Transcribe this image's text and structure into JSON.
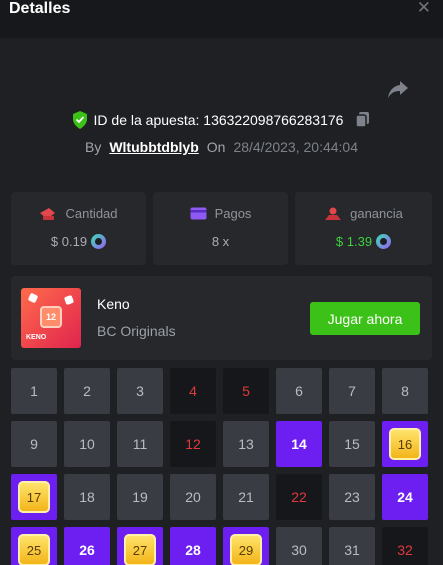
{
  "header": {
    "title": "Detalles",
    "close_icon": "close-icon"
  },
  "bet": {
    "id_text": "ID de la apuesta: 136322098766283176",
    "by_label": "By",
    "username": "Wltubbtdblyb",
    "on_label": "On",
    "date": "28/4/2023, 20:44:04"
  },
  "stats": [
    {
      "label": "Cantidad",
      "value": "$ 0.19",
      "icon": "money-icon"
    },
    {
      "label": "Pagos",
      "value": "8 x",
      "icon": "card-icon"
    },
    {
      "label": "ganancia",
      "value": "$ 1.39",
      "icon": "profit-icon"
    }
  ],
  "game": {
    "name": "Keno",
    "provider": "BC Originals",
    "thumb_ball": "12",
    "thumb_label": "KENO",
    "play_label": "Jugar ahora"
  },
  "grid": {
    "cells": [
      {
        "n": "1",
        "s": "normal"
      },
      {
        "n": "2",
        "s": "normal"
      },
      {
        "n": "3",
        "s": "normal"
      },
      {
        "n": "4",
        "s": "miss"
      },
      {
        "n": "5",
        "s": "miss"
      },
      {
        "n": "6",
        "s": "normal"
      },
      {
        "n": "7",
        "s": "normal"
      },
      {
        "n": "8",
        "s": "normal"
      },
      {
        "n": "9",
        "s": "normal"
      },
      {
        "n": "10",
        "s": "normal"
      },
      {
        "n": "11",
        "s": "normal"
      },
      {
        "n": "12",
        "s": "miss"
      },
      {
        "n": "13",
        "s": "normal"
      },
      {
        "n": "14",
        "s": "hit"
      },
      {
        "n": "15",
        "s": "normal"
      },
      {
        "n": "16",
        "s": "win"
      },
      {
        "n": "17",
        "s": "win"
      },
      {
        "n": "18",
        "s": "normal"
      },
      {
        "n": "19",
        "s": "normal"
      },
      {
        "n": "20",
        "s": "normal"
      },
      {
        "n": "21",
        "s": "normal"
      },
      {
        "n": "22",
        "s": "miss"
      },
      {
        "n": "23",
        "s": "normal"
      },
      {
        "n": "24",
        "s": "hit"
      },
      {
        "n": "25",
        "s": "win"
      },
      {
        "n": "26",
        "s": "hit"
      },
      {
        "n": "27",
        "s": "win"
      },
      {
        "n": "28",
        "s": "hit"
      },
      {
        "n": "29",
        "s": "win"
      },
      {
        "n": "30",
        "s": "normal"
      },
      {
        "n": "31",
        "s": "normal"
      },
      {
        "n": "32",
        "s": "miss"
      }
    ]
  },
  "colors": {
    "accent": "#6d1ef1",
    "play_button": "#3bc117",
    "win_text": "#3fcf3f",
    "miss_text": "#e0393b"
  }
}
